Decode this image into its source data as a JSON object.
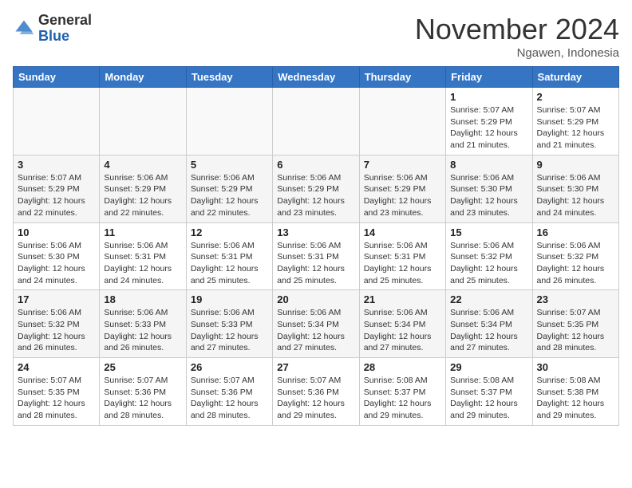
{
  "header": {
    "logo_general": "General",
    "logo_blue": "Blue",
    "month_title": "November 2024",
    "location": "Ngawen, Indonesia"
  },
  "weekdays": [
    "Sunday",
    "Monday",
    "Tuesday",
    "Wednesday",
    "Thursday",
    "Friday",
    "Saturday"
  ],
  "weeks": [
    [
      {
        "day": "",
        "info": ""
      },
      {
        "day": "",
        "info": ""
      },
      {
        "day": "",
        "info": ""
      },
      {
        "day": "",
        "info": ""
      },
      {
        "day": "",
        "info": ""
      },
      {
        "day": "1",
        "info": "Sunrise: 5:07 AM\nSunset: 5:29 PM\nDaylight: 12 hours\nand 21 minutes."
      },
      {
        "day": "2",
        "info": "Sunrise: 5:07 AM\nSunset: 5:29 PM\nDaylight: 12 hours\nand 21 minutes."
      }
    ],
    [
      {
        "day": "3",
        "info": "Sunrise: 5:07 AM\nSunset: 5:29 PM\nDaylight: 12 hours\nand 22 minutes."
      },
      {
        "day": "4",
        "info": "Sunrise: 5:06 AM\nSunset: 5:29 PM\nDaylight: 12 hours\nand 22 minutes."
      },
      {
        "day": "5",
        "info": "Sunrise: 5:06 AM\nSunset: 5:29 PM\nDaylight: 12 hours\nand 22 minutes."
      },
      {
        "day": "6",
        "info": "Sunrise: 5:06 AM\nSunset: 5:29 PM\nDaylight: 12 hours\nand 23 minutes."
      },
      {
        "day": "7",
        "info": "Sunrise: 5:06 AM\nSunset: 5:29 PM\nDaylight: 12 hours\nand 23 minutes."
      },
      {
        "day": "8",
        "info": "Sunrise: 5:06 AM\nSunset: 5:30 PM\nDaylight: 12 hours\nand 23 minutes."
      },
      {
        "day": "9",
        "info": "Sunrise: 5:06 AM\nSunset: 5:30 PM\nDaylight: 12 hours\nand 24 minutes."
      }
    ],
    [
      {
        "day": "10",
        "info": "Sunrise: 5:06 AM\nSunset: 5:30 PM\nDaylight: 12 hours\nand 24 minutes."
      },
      {
        "day": "11",
        "info": "Sunrise: 5:06 AM\nSunset: 5:31 PM\nDaylight: 12 hours\nand 24 minutes."
      },
      {
        "day": "12",
        "info": "Sunrise: 5:06 AM\nSunset: 5:31 PM\nDaylight: 12 hours\nand 25 minutes."
      },
      {
        "day": "13",
        "info": "Sunrise: 5:06 AM\nSunset: 5:31 PM\nDaylight: 12 hours\nand 25 minutes."
      },
      {
        "day": "14",
        "info": "Sunrise: 5:06 AM\nSunset: 5:31 PM\nDaylight: 12 hours\nand 25 minutes."
      },
      {
        "day": "15",
        "info": "Sunrise: 5:06 AM\nSunset: 5:32 PM\nDaylight: 12 hours\nand 25 minutes."
      },
      {
        "day": "16",
        "info": "Sunrise: 5:06 AM\nSunset: 5:32 PM\nDaylight: 12 hours\nand 26 minutes."
      }
    ],
    [
      {
        "day": "17",
        "info": "Sunrise: 5:06 AM\nSunset: 5:32 PM\nDaylight: 12 hours\nand 26 minutes."
      },
      {
        "day": "18",
        "info": "Sunrise: 5:06 AM\nSunset: 5:33 PM\nDaylight: 12 hours\nand 26 minutes."
      },
      {
        "day": "19",
        "info": "Sunrise: 5:06 AM\nSunset: 5:33 PM\nDaylight: 12 hours\nand 27 minutes."
      },
      {
        "day": "20",
        "info": "Sunrise: 5:06 AM\nSunset: 5:34 PM\nDaylight: 12 hours\nand 27 minutes."
      },
      {
        "day": "21",
        "info": "Sunrise: 5:06 AM\nSunset: 5:34 PM\nDaylight: 12 hours\nand 27 minutes."
      },
      {
        "day": "22",
        "info": "Sunrise: 5:06 AM\nSunset: 5:34 PM\nDaylight: 12 hours\nand 27 minutes."
      },
      {
        "day": "23",
        "info": "Sunrise: 5:07 AM\nSunset: 5:35 PM\nDaylight: 12 hours\nand 28 minutes."
      }
    ],
    [
      {
        "day": "24",
        "info": "Sunrise: 5:07 AM\nSunset: 5:35 PM\nDaylight: 12 hours\nand 28 minutes."
      },
      {
        "day": "25",
        "info": "Sunrise: 5:07 AM\nSunset: 5:36 PM\nDaylight: 12 hours\nand 28 minutes."
      },
      {
        "day": "26",
        "info": "Sunrise: 5:07 AM\nSunset: 5:36 PM\nDaylight: 12 hours\nand 28 minutes."
      },
      {
        "day": "27",
        "info": "Sunrise: 5:07 AM\nSunset: 5:36 PM\nDaylight: 12 hours\nand 29 minutes."
      },
      {
        "day": "28",
        "info": "Sunrise: 5:08 AM\nSunset: 5:37 PM\nDaylight: 12 hours\nand 29 minutes."
      },
      {
        "day": "29",
        "info": "Sunrise: 5:08 AM\nSunset: 5:37 PM\nDaylight: 12 hours\nand 29 minutes."
      },
      {
        "day": "30",
        "info": "Sunrise: 5:08 AM\nSunset: 5:38 PM\nDaylight: 12 hours\nand 29 minutes."
      }
    ]
  ]
}
